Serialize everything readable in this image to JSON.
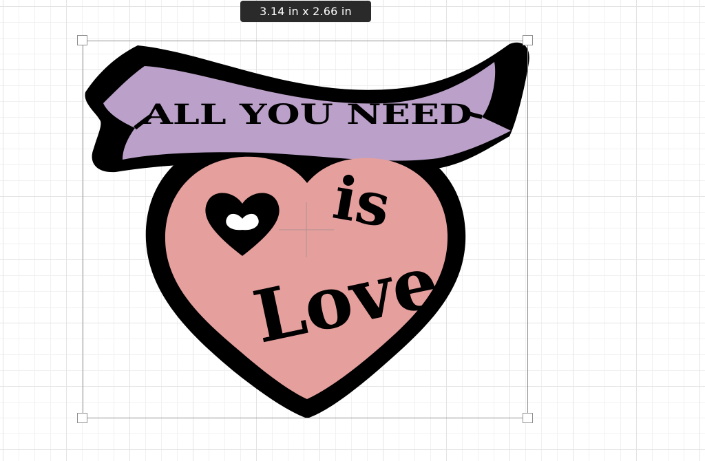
{
  "dimensions": {
    "width": "3.14",
    "height": "2.66",
    "unit": "in",
    "label": "3.14  in x 2.66  in"
  },
  "design": {
    "banner_text": "ALL YOU NEED",
    "is_text": "is",
    "love_text": "Love",
    "colors": {
      "banner_fill": "#bba1c9",
      "heart_fill": "#e59f9d",
      "outline": "#000000"
    }
  },
  "icons": {
    "small_heart": "heart-icon",
    "center": "crosshair-icon"
  }
}
